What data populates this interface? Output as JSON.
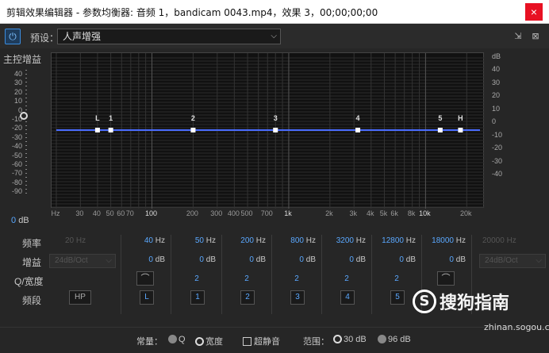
{
  "window": {
    "title": "剪辑效果编辑器 - 参数均衡器: 音频 1，bandicam 0043.mp4，效果 3，00;00;00;00",
    "close_glyph": "×"
  },
  "toolbar": {
    "power_glyph": "⏻",
    "preset_label": "预设：",
    "preset_value": "人声增强",
    "preset_chevron": "⌵",
    "icon1": "⇲",
    "icon2": "⊠"
  },
  "master": {
    "label": "主控增益",
    "ticks": [
      "40",
      "30",
      "20",
      "10",
      "0",
      "-10",
      "-20",
      "-30",
      "-40",
      "-50",
      "-60",
      "-70",
      "-80",
      "-90"
    ],
    "value": "0",
    "unit": "dB"
  },
  "graph": {
    "db_unit": "dB",
    "db_ticks": [
      "40",
      "30",
      "20",
      "10",
      "0",
      "-10",
      "-20",
      "-30",
      "-40"
    ],
    "freq_ticks": [
      "Hz",
      "30",
      "40",
      "50",
      "60",
      "70",
      "100",
      "200",
      "300",
      "400",
      "500",
      "700",
      "1k",
      "2k",
      "3k",
      "4k",
      "5k",
      "6k",
      "8k",
      "10k",
      "20k"
    ],
    "curve_color": "#4a6cff",
    "nodes": [
      {
        "label": "L",
        "freq": 40
      },
      {
        "label": "1",
        "freq": 50
      },
      {
        "label": "2",
        "freq": 200
      },
      {
        "label": "3",
        "freq": 800
      },
      {
        "label": "4",
        "freq": 3200
      },
      {
        "label": "5",
        "freq": 12800
      },
      {
        "label": "H",
        "freq": 18000
      }
    ]
  },
  "rows": {
    "freq": "频率",
    "gain": "增益",
    "q": "Q/宽度",
    "band": "频段"
  },
  "hp": {
    "freq": "20 Hz",
    "slope": "24dB/Oct",
    "button": "HP"
  },
  "lp": {
    "freq": "20000 Hz",
    "slope": "24dB/Oct"
  },
  "bands": [
    {
      "freq": "40",
      "gain": "0",
      "q": "",
      "button": "L",
      "shape": "⌒"
    },
    {
      "freq": "50",
      "gain": "0",
      "q": "2",
      "button": "1"
    },
    {
      "freq": "200",
      "gain": "0",
      "q": "2",
      "button": "2"
    },
    {
      "freq": "800",
      "gain": "0",
      "q": "2",
      "button": "3"
    },
    {
      "freq": "3200",
      "gain": "0",
      "q": "2",
      "button": "4"
    },
    {
      "freq": "12800",
      "gain": "0",
      "q": "2",
      "button": "5"
    },
    {
      "freq": "18000",
      "gain": "0",
      "q": "",
      "button": "",
      "shape": "⌒"
    }
  ],
  "units": {
    "hz": "Hz",
    "db": "dB"
  },
  "footer": {
    "constant_label": "常量：",
    "q_label": "Q",
    "width_label": "宽度",
    "ultraquiet_label": "超静音",
    "range_label": "范围：",
    "range_30": "30 dB",
    "range_96": "96 dB"
  },
  "watermark": {
    "logo": "S",
    "name": "搜狗指南",
    "url": "zhinan.sogou.com"
  }
}
